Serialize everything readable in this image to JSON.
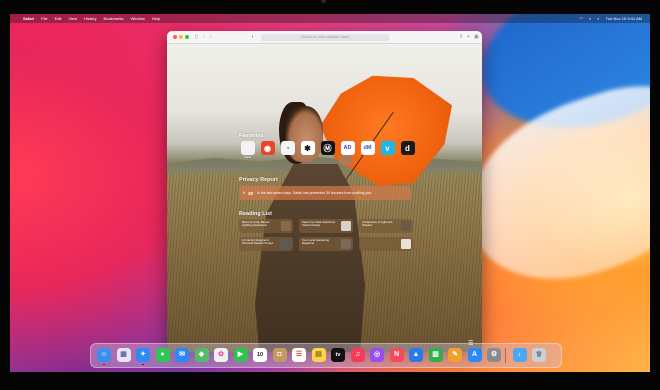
{
  "menubar": {
    "apple_glyph": "",
    "app_name": "Safari",
    "items": [
      "File",
      "Edit",
      "View",
      "History",
      "Bookmarks",
      "Window",
      "Help"
    ],
    "clock": "Tue Nov 10  9:41 AM"
  },
  "safari": {
    "address_placeholder": "Search or enter website name",
    "start_page": {
      "favorites_title": "Favorites",
      "favorites": [
        {
          "label": "Apple",
          "glyph": "",
          "bg": "#f2f2f2",
          "fg": "#333333"
        },
        {
          "label": "",
          "glyph": "◉",
          "bg": "#e8452c",
          "fg": "#ffffff"
        },
        {
          "label": "",
          "glyph": "◔",
          "bg": "#f4f4f4",
          "fg": "#777777"
        },
        {
          "label": "",
          "glyph": "✱",
          "bg": "#ffffff",
          "fg": "#111111"
        },
        {
          "label": "",
          "glyph": "Ⓜ",
          "bg": "#111111",
          "fg": "#ffffff"
        },
        {
          "label": "",
          "glyph": "AD",
          "bg": "#ffffff",
          "fg": "#3b3bb0"
        },
        {
          "label": "",
          "glyph": "dM",
          "bg": "#ffffff",
          "fg": "#2a5ac8"
        },
        {
          "label": "",
          "glyph": "v",
          "bg": "#1ab7ea",
          "fg": "#ffffff"
        },
        {
          "label": "",
          "glyph": "d",
          "bg": "#1a1a1a",
          "fg": "#ffffff"
        }
      ],
      "privacy_title": "Privacy Report",
      "privacy": {
        "count": "30",
        "text": "In the last seven days, Safari has prevented 30 trackers from profiling you."
      },
      "reading_title": "Reading List",
      "reading_list": [
        {
          "text": "Best out of the Banner Lighting Inspirations",
          "thumb": "#8a6a4a"
        },
        {
          "text": "Tales from Dark Apartment Interior Design",
          "thumb": "#d8d2c8"
        },
        {
          "text": "Architecture of Light and Shadow",
          "thumb": "#6a5a4a"
        },
        {
          "text": "An Interior Designer's Personal Passion Project",
          "thumb": "#5a5a5a"
        },
        {
          "text": "Your Local Gardening Magazine",
          "thumb": "#7a6a5a"
        },
        {
          "text": "",
          "thumb": "#e8e2d8"
        }
      ]
    }
  },
  "dock": {
    "apps": [
      {
        "name": "finder",
        "glyph": "☺",
        "bg": "#3d8ef0",
        "running": true
      },
      {
        "name": "launchpad",
        "glyph": "▦",
        "bg": "#e9e4f2",
        "fg": "#6a5fb0",
        "running": false
      },
      {
        "name": "safari",
        "glyph": "✦",
        "bg": "#2e8cf0",
        "running": true
      },
      {
        "name": "messages",
        "glyph": "●",
        "bg": "#31c651",
        "running": false
      },
      {
        "name": "mail",
        "glyph": "✉",
        "bg": "#2f86f5",
        "running": false
      },
      {
        "name": "maps",
        "glyph": "◈",
        "bg": "#58b86a",
        "running": false
      },
      {
        "name": "photos",
        "glyph": "✿",
        "bg": "#f0f0f0",
        "fg": "#e85a9a",
        "running": false
      },
      {
        "name": "facetime",
        "glyph": "▶",
        "bg": "#2fc24e",
        "running": false
      },
      {
        "name": "calendar",
        "glyph": "10",
        "bg": "#ffffff",
        "fg": "#222222",
        "running": false
      },
      {
        "name": "contacts",
        "glyph": "◘",
        "bg": "#c59a62",
        "running": false
      },
      {
        "name": "reminders",
        "glyph": "☰",
        "bg": "#ffffff",
        "fg": "#e85a2a",
        "running": false
      },
      {
        "name": "notes",
        "glyph": "▤",
        "bg": "#fbd54a",
        "fg": "#8a6a1a",
        "running": false
      },
      {
        "name": "tv",
        "glyph": "tv",
        "bg": "#111111",
        "running": false
      },
      {
        "name": "music",
        "glyph": "♫",
        "bg": "#f53b5a",
        "running": false
      },
      {
        "name": "podcasts",
        "glyph": "◎",
        "bg": "#9a4ef0",
        "running": false
      },
      {
        "name": "news",
        "glyph": "N",
        "bg": "#f44a5a",
        "running": false
      },
      {
        "name": "keynote",
        "glyph": "▲",
        "bg": "#2a7ae8",
        "running": false
      },
      {
        "name": "numbers",
        "glyph": "▥",
        "bg": "#2fae4a",
        "running": false
      },
      {
        "name": "pages",
        "glyph": "✎",
        "bg": "#f5a02a",
        "running": false
      },
      {
        "name": "app-store",
        "glyph": "A",
        "bg": "#2a8af5",
        "running": false
      },
      {
        "name": "system-preferences",
        "glyph": "⚙",
        "bg": "#8a8a90",
        "running": false
      },
      {
        "name": "downloads",
        "glyph": "↓",
        "bg": "#4aa8f0",
        "running": false
      },
      {
        "name": "trash",
        "glyph": "🗑",
        "bg": "#c9d0d8",
        "fg": "#7a8088",
        "running": false
      }
    ]
  }
}
